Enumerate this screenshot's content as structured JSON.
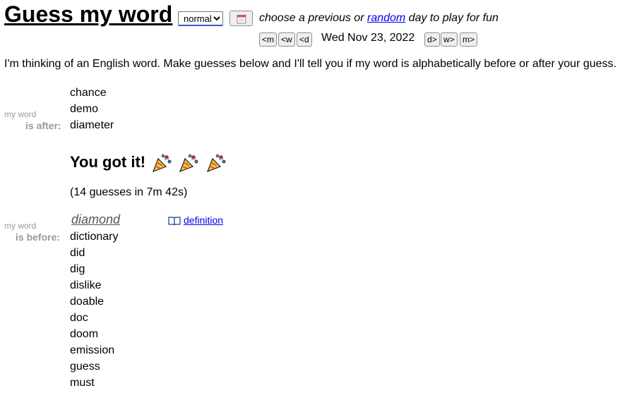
{
  "header": {
    "title": "Guess my word",
    "difficulty": "normal",
    "difficulty_options": [
      "normal"
    ],
    "choose_prefix": "choose a previous or ",
    "random_link": "random",
    "choose_suffix": " day to play for fun"
  },
  "nav": {
    "prev_month": "<m",
    "prev_week": "<w",
    "prev_day": "<d",
    "date": "Wed Nov 23, 2022",
    "next_day": "d>",
    "next_week": "w>",
    "next_month": "m>"
  },
  "intro": "I'm thinking of an English word. Make guesses below and I'll tell you if my word is alphabetically before or after your guess.",
  "after_section": {
    "label_small": "my word",
    "label_bold": "is after:",
    "words": [
      "chance",
      "demo",
      "diameter"
    ]
  },
  "result": {
    "heading": "You got it!",
    "celebration_icon": "party-popper-icon",
    "stats": "(14 guesses in 7m 42s)",
    "answer": "diamond",
    "definition_label": "definition",
    "definition_icon": "book-icon"
  },
  "before_section": {
    "label_small": "my word",
    "label_bold": "is before:",
    "words": [
      "dictionary",
      "did",
      "dig",
      "dislike",
      "doable",
      "doc",
      "doom",
      "emission",
      "guess",
      "must"
    ]
  },
  "colors": {
    "link": "#0000ee",
    "label_gray": "#999999",
    "select_focus": "#2b5dcd"
  }
}
